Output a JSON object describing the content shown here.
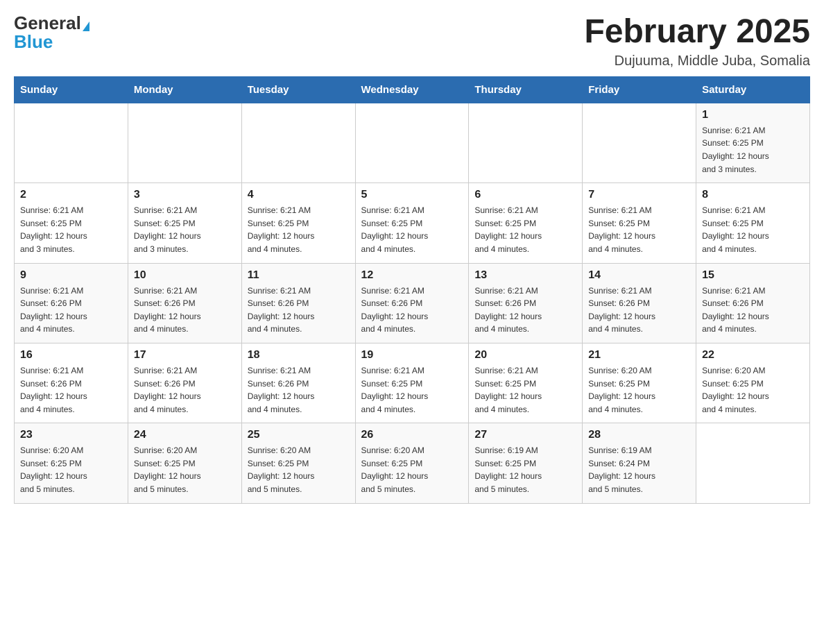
{
  "header": {
    "logo_general": "General",
    "logo_blue": "Blue",
    "month_title": "February 2025",
    "location": "Dujuuma, Middle Juba, Somalia"
  },
  "weekdays": [
    "Sunday",
    "Monday",
    "Tuesday",
    "Wednesday",
    "Thursday",
    "Friday",
    "Saturday"
  ],
  "weeks": [
    {
      "days": [
        {
          "num": "",
          "info": ""
        },
        {
          "num": "",
          "info": ""
        },
        {
          "num": "",
          "info": ""
        },
        {
          "num": "",
          "info": ""
        },
        {
          "num": "",
          "info": ""
        },
        {
          "num": "",
          "info": ""
        },
        {
          "num": "1",
          "info": "Sunrise: 6:21 AM\nSunset: 6:25 PM\nDaylight: 12 hours\nand 3 minutes."
        }
      ]
    },
    {
      "days": [
        {
          "num": "2",
          "info": "Sunrise: 6:21 AM\nSunset: 6:25 PM\nDaylight: 12 hours\nand 3 minutes."
        },
        {
          "num": "3",
          "info": "Sunrise: 6:21 AM\nSunset: 6:25 PM\nDaylight: 12 hours\nand 3 minutes."
        },
        {
          "num": "4",
          "info": "Sunrise: 6:21 AM\nSunset: 6:25 PM\nDaylight: 12 hours\nand 4 minutes."
        },
        {
          "num": "5",
          "info": "Sunrise: 6:21 AM\nSunset: 6:25 PM\nDaylight: 12 hours\nand 4 minutes."
        },
        {
          "num": "6",
          "info": "Sunrise: 6:21 AM\nSunset: 6:25 PM\nDaylight: 12 hours\nand 4 minutes."
        },
        {
          "num": "7",
          "info": "Sunrise: 6:21 AM\nSunset: 6:25 PM\nDaylight: 12 hours\nand 4 minutes."
        },
        {
          "num": "8",
          "info": "Sunrise: 6:21 AM\nSunset: 6:25 PM\nDaylight: 12 hours\nand 4 minutes."
        }
      ]
    },
    {
      "days": [
        {
          "num": "9",
          "info": "Sunrise: 6:21 AM\nSunset: 6:26 PM\nDaylight: 12 hours\nand 4 minutes."
        },
        {
          "num": "10",
          "info": "Sunrise: 6:21 AM\nSunset: 6:26 PM\nDaylight: 12 hours\nand 4 minutes."
        },
        {
          "num": "11",
          "info": "Sunrise: 6:21 AM\nSunset: 6:26 PM\nDaylight: 12 hours\nand 4 minutes."
        },
        {
          "num": "12",
          "info": "Sunrise: 6:21 AM\nSunset: 6:26 PM\nDaylight: 12 hours\nand 4 minutes."
        },
        {
          "num": "13",
          "info": "Sunrise: 6:21 AM\nSunset: 6:26 PM\nDaylight: 12 hours\nand 4 minutes."
        },
        {
          "num": "14",
          "info": "Sunrise: 6:21 AM\nSunset: 6:26 PM\nDaylight: 12 hours\nand 4 minutes."
        },
        {
          "num": "15",
          "info": "Sunrise: 6:21 AM\nSunset: 6:26 PM\nDaylight: 12 hours\nand 4 minutes."
        }
      ]
    },
    {
      "days": [
        {
          "num": "16",
          "info": "Sunrise: 6:21 AM\nSunset: 6:26 PM\nDaylight: 12 hours\nand 4 minutes."
        },
        {
          "num": "17",
          "info": "Sunrise: 6:21 AM\nSunset: 6:26 PM\nDaylight: 12 hours\nand 4 minutes."
        },
        {
          "num": "18",
          "info": "Sunrise: 6:21 AM\nSunset: 6:26 PM\nDaylight: 12 hours\nand 4 minutes."
        },
        {
          "num": "19",
          "info": "Sunrise: 6:21 AM\nSunset: 6:25 PM\nDaylight: 12 hours\nand 4 minutes."
        },
        {
          "num": "20",
          "info": "Sunrise: 6:21 AM\nSunset: 6:25 PM\nDaylight: 12 hours\nand 4 minutes."
        },
        {
          "num": "21",
          "info": "Sunrise: 6:20 AM\nSunset: 6:25 PM\nDaylight: 12 hours\nand 4 minutes."
        },
        {
          "num": "22",
          "info": "Sunrise: 6:20 AM\nSunset: 6:25 PM\nDaylight: 12 hours\nand 4 minutes."
        }
      ]
    },
    {
      "days": [
        {
          "num": "23",
          "info": "Sunrise: 6:20 AM\nSunset: 6:25 PM\nDaylight: 12 hours\nand 5 minutes."
        },
        {
          "num": "24",
          "info": "Sunrise: 6:20 AM\nSunset: 6:25 PM\nDaylight: 12 hours\nand 5 minutes."
        },
        {
          "num": "25",
          "info": "Sunrise: 6:20 AM\nSunset: 6:25 PM\nDaylight: 12 hours\nand 5 minutes."
        },
        {
          "num": "26",
          "info": "Sunrise: 6:20 AM\nSunset: 6:25 PM\nDaylight: 12 hours\nand 5 minutes."
        },
        {
          "num": "27",
          "info": "Sunrise: 6:19 AM\nSunset: 6:25 PM\nDaylight: 12 hours\nand 5 minutes."
        },
        {
          "num": "28",
          "info": "Sunrise: 6:19 AM\nSunset: 6:24 PM\nDaylight: 12 hours\nand 5 minutes."
        },
        {
          "num": "",
          "info": ""
        }
      ]
    }
  ]
}
